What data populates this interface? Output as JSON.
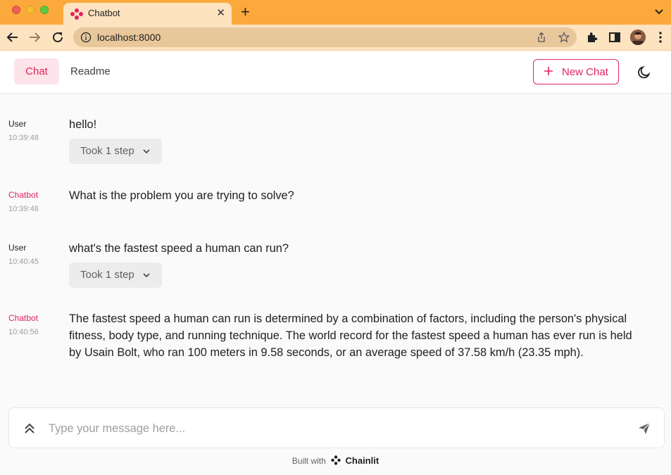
{
  "browser": {
    "tab_title": "Chatbot",
    "url": "localhost:8000"
  },
  "header": {
    "nav_chat": "Chat",
    "nav_readme": "Readme",
    "new_chat_label": "New Chat"
  },
  "messages": [
    {
      "author": "User",
      "time": "10:39:48",
      "text": "hello!",
      "step": "Took 1 step"
    },
    {
      "author": "Chatbot",
      "time": "10:39:48",
      "text": "What is the problem you are trying to solve?"
    },
    {
      "author": "User",
      "time": "10:40:45",
      "text": "what's the fastest speed a human can run?",
      "step": "Took 1 step"
    },
    {
      "author": "Chatbot",
      "time": "10:40:56",
      "lines": [
        "The fastest speed a human can run is determined by a combination of factors, including the person's physical",
        "fitness, body type, and running technique. The world record for the fastest speed a human has ever run is held",
        "by Usain Bolt, who ran 100 meters in 9.58 seconds, or an average speed of 37.58 km/h (23.35 mph)."
      ]
    }
  ],
  "composer": {
    "placeholder": "Type your message here..."
  },
  "footer": {
    "built_with": "Built with",
    "brand": "Chainlit"
  },
  "colors": {
    "accent": "#e0245e",
    "chrome": "#fba93c"
  },
  "icons": [
    "back-arrow-icon",
    "forward-arrow-icon",
    "reload-icon",
    "info-icon",
    "share-icon",
    "star-icon",
    "extensions-icon",
    "sidebar-icon",
    "kebab-menu-icon",
    "plus-icon",
    "moon-icon",
    "chevron-down-icon",
    "double-chevron-up-icon",
    "send-icon"
  ]
}
